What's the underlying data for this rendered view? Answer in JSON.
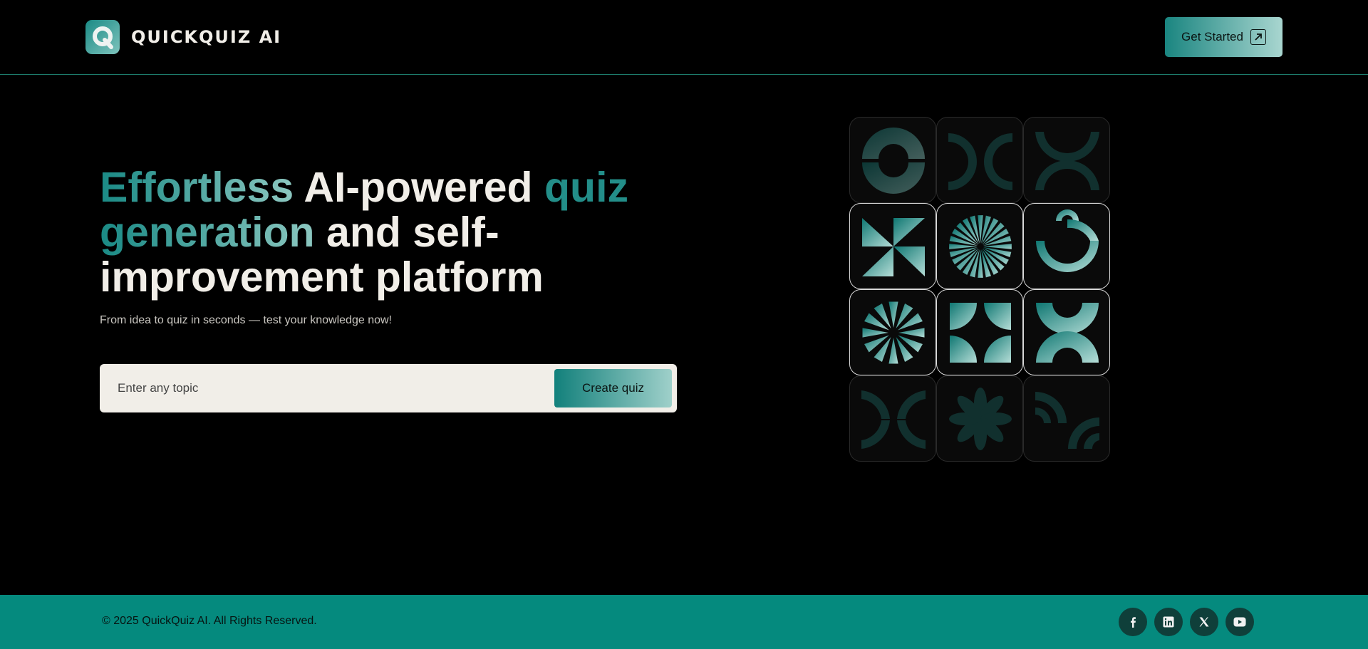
{
  "header": {
    "brand_name": "QUICKQUIZ AI",
    "logo_letter": "Q",
    "cta_label": "Get Started"
  },
  "hero": {
    "headline": {
      "part1": "Effortless",
      "part2": " AI-powered ",
      "part3": "quiz",
      "part4": "generation",
      "part5": " and self-improvement platform"
    },
    "subtitle": "From idea to quiz in seconds — test your knowledge now!",
    "topic_placeholder": "Enter any topic",
    "topic_value": "",
    "create_button": "Create quiz"
  },
  "tiles": [
    {
      "shape": "arch-pair-icon"
    },
    {
      "shape": "c-pair-icon"
    },
    {
      "shape": "leaf-wings-icon"
    },
    {
      "shape": "pinwheel-icon"
    },
    {
      "shape": "starburst-icon"
    },
    {
      "shape": "smile-arc-icon"
    },
    {
      "shape": "sun-rays-icon"
    },
    {
      "shape": "quad-star-icon"
    },
    {
      "shape": "arch-wings-icon"
    },
    {
      "shape": "leaf-wings-icon"
    },
    {
      "shape": "flower-icon"
    },
    {
      "shape": "c-pair-icon"
    }
  ],
  "footer": {
    "copyright": "© 2025 QuickQuiz AI. All Rights Reserved.",
    "social": [
      "facebook-icon",
      "linkedin-icon",
      "x-icon",
      "youtube-icon"
    ]
  },
  "colors": {
    "accent": "#058a7e",
    "accent_dark": "#1a8a85",
    "accent_light": "#a9d6d0",
    "text_light": "#f1eee8",
    "background": "#000000"
  }
}
